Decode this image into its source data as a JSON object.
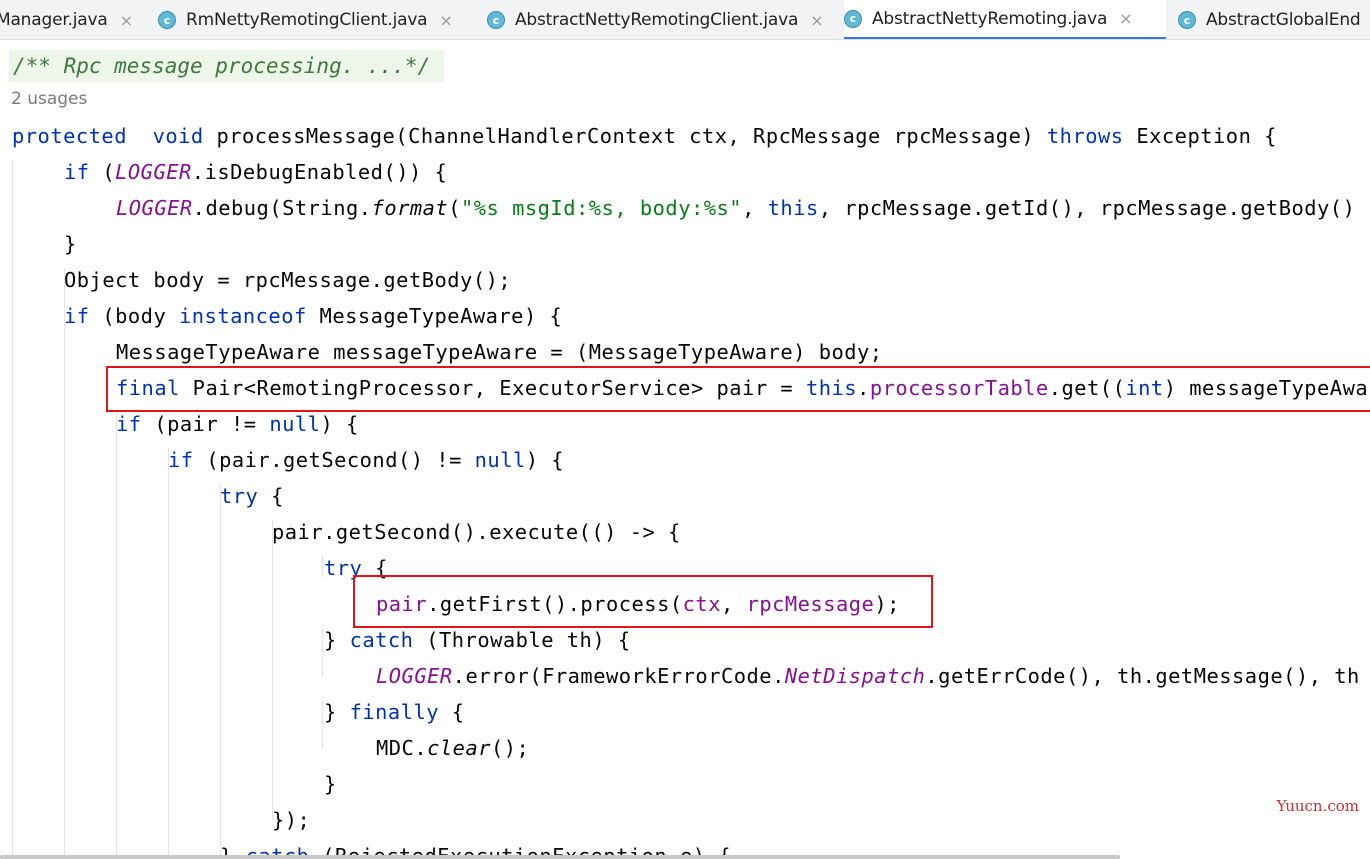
{
  "tabs": [
    {
      "label": "Manager.java",
      "active": false,
      "icon": "class-icon"
    },
    {
      "label": "RmNettyRemotingClient.java",
      "active": false,
      "icon": "class-icon"
    },
    {
      "label": "AbstractNettyRemotingClient.java",
      "active": false,
      "icon": "class-icon"
    },
    {
      "label": "AbstractNettyRemoting.java",
      "active": true,
      "icon": "class-icon"
    },
    {
      "label": "AbstractGlobalEnd",
      "active": false,
      "icon": "class-icon"
    }
  ],
  "tab_close_glyph": "×",
  "tab_icon_letter": "c",
  "editor": {
    "doc_comment": "/** Rpc message processing. ...*/",
    "usages": "2 usages",
    "lines": [
      [
        [
          "kw",
          "protected"
        ],
        [
          "",
          "  "
        ],
        [
          "kw",
          "void"
        ],
        [
          "",
          " processMessage(ChannelHandlerContext ctx, RpcMessage rpcMessage) "
        ],
        [
          "kw",
          "throws"
        ],
        [
          "",
          " Exception {"
        ]
      ],
      [
        [
          "kw",
          "if"
        ],
        [
          "",
          " ("
        ],
        [
          "fld it",
          "LOGGER"
        ],
        [
          "",
          ".isDebugEnabled()) {"
        ]
      ],
      [
        [
          "fld it",
          "LOGGER"
        ],
        [
          "",
          ".debug(String."
        ],
        [
          "it",
          "format"
        ],
        [
          "",
          "("
        ],
        [
          "str",
          "\"%s msgId:%s, body:%s\""
        ],
        [
          "",
          ", "
        ],
        [
          "kw",
          "this"
        ],
        [
          "",
          ", rpcMessage.getId(), rpcMessage.getBody()"
        ]
      ],
      [
        [
          "",
          "}"
        ]
      ],
      [
        [
          "",
          "Object body = rpcMessage.getBody();"
        ]
      ],
      [
        [
          "kw",
          "if"
        ],
        [
          "",
          " (body "
        ],
        [
          "kw",
          "instanceof"
        ],
        [
          "",
          " MessageTypeAware) {"
        ]
      ],
      [
        [
          "",
          "MessageTypeAware messageTypeAware = (MessageTypeAware) body;"
        ]
      ],
      [
        [
          "kw",
          "final"
        ],
        [
          "",
          " Pair<RemotingProcessor, ExecutorService> pair = "
        ],
        [
          "kw",
          "this"
        ],
        [
          "",
          "."
        ],
        [
          "fld",
          "processorTable"
        ],
        [
          "",
          ".get(("
        ],
        [
          "kw",
          "int"
        ],
        [
          "",
          ") messageTypeAware"
        ]
      ],
      [
        [
          "kw",
          "if"
        ],
        [
          "",
          " (pair != "
        ],
        [
          "kw",
          "null"
        ],
        [
          "",
          ") {"
        ]
      ],
      [
        [
          "kw",
          "if"
        ],
        [
          "",
          " (pair.getSecond() != "
        ],
        [
          "kw",
          "null"
        ],
        [
          "",
          ") {"
        ]
      ],
      [
        [
          "kw",
          "try"
        ],
        [
          "",
          " {"
        ]
      ],
      [
        [
          "",
          "pair.getSecond().execute(() -> {"
        ]
      ],
      [
        [
          "kw",
          "try"
        ],
        [
          "",
          " {"
        ]
      ],
      [
        [
          "fld",
          "pair"
        ],
        [
          "",
          ".getFirst().process("
        ],
        [
          "fld",
          "ctx"
        ],
        [
          "",
          ", "
        ],
        [
          "fld",
          "rpcMessage"
        ],
        [
          "",
          ");"
        ]
      ],
      [
        [
          "",
          "} "
        ],
        [
          "kw",
          "catch"
        ],
        [
          "",
          " (Throwable th) {"
        ]
      ],
      [
        [
          "fld it",
          "LOGGER"
        ],
        [
          "",
          ".error(FrameworkErrorCode."
        ],
        [
          "fld it",
          "NetDispatch"
        ],
        [
          "",
          ".getErrCode(), th.getMessage(), th"
        ]
      ],
      [
        [
          "",
          "} "
        ],
        [
          "kw",
          "finally"
        ],
        [
          "",
          " {"
        ]
      ],
      [
        [
          "",
          "MDC."
        ],
        [
          "it",
          "clear"
        ],
        [
          "",
          "();"
        ]
      ],
      [
        [
          "",
          "}"
        ]
      ],
      [
        [
          "",
          "});"
        ]
      ],
      [
        [
          "",
          "} "
        ],
        [
          "kw",
          "catch"
        ],
        [
          "",
          " (RejectedExecutionException e) {"
        ]
      ]
    ]
  },
  "watermark": "Yuucn.com",
  "colors": {
    "keyword": "#0033b3",
    "field": "#871094",
    "string": "#067d17",
    "highlight_box": "#e1161a",
    "active_tab": "#3574f0"
  }
}
